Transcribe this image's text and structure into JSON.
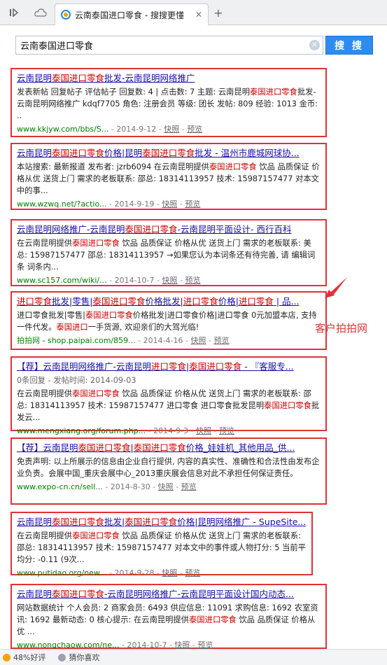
{
  "browser": {
    "tab_title": "云南泰国进口零食 - 搜搜更懂",
    "tab_close": "✕",
    "new_tab": "+"
  },
  "search": {
    "query": "云南泰国进口零食",
    "button_label": "搜 搜"
  },
  "results": [
    {
      "title": "云南昆明泰国进口零食批发-云南昆明网络推广",
      "snippet": "发表新帖 回复帖子 评估帖子 回复数: 4 | 点击数: 7 主题: 云南昆明泰国进口零食批发-云南昆明网络推广 kdqf7705 角色: 注册会员 等级: 团长 发帖: 809 经验: 1013 金币: ..",
      "url": "www.kkjyw.com/bbs/S...",
      "date": "2014-9-12",
      "snapshot": "快照",
      "preview": "预览"
    },
    {
      "title": "云南昆明泰国进口零食价格|昆明泰国进口零食批发 - 温州市鹿城网球协...",
      "snippet": "本站搜索: 最新报道 发布者: jzrb6094 在云南昆明提供泰国进口零食 饮品 品质保证 价格从优 送货上门 需求的老板联系: 邵总: 18314113957 技术: 15987157477 对本文中的事...",
      "url": "www.wzwq.net/?actio...",
      "date": "2014-9-19",
      "snapshot": "快照",
      "preview": "预览"
    },
    {
      "title": "云南昆明网络推广-云南昆明泰国进口零食-云南昆明平面设计- 西行百科",
      "snippet": "在云南昆明提供泰国进口零食 饮品 品质保证 价格从优 送货上门 需求的老板联系: 美总: 15987157477 邵总: 18314113957 →如果您认为本词条还有待完善, 请 编辑词条 词条内...",
      "url": "www.sc157.com/wiki/...",
      "date": "2014-10-7",
      "snapshot": "快照",
      "preview": "预览"
    },
    {
      "title": "进口零食批发|零售|泰国进口零食价格批发|进口零食价格|进口零食 | 品...",
      "snippet": "进口零食批发|零售|泰国进口零食价格批发|进口零食价格|进口零食 0元加盟本店, 支持一件代发。泰国进口一手货源, 欢迎亲们的大驾光临!",
      "url_prefix": "拍拍网",
      "url": "shop.paipai.com/859...",
      "date": "2014-4-16",
      "snapshot": "快照",
      "preview": "预览"
    },
    {
      "title": "【荐】云南昆明网络推广-云南昆明进口零食|泰国进口零食 - 『客服专...",
      "sub": "0条回复 - 发帖时间: 2014-09-03",
      "snippet": "在云南昆明提供泰国进口零食 饮品 品质保证 价格从优 送货上门 需求的老板联系: 邵总: 18314113957 技术: 15987157477 进口零食 进口零食批发昆明泰国进口零食批发云...",
      "url": "www.mengxiang.org/forum.php...",
      "date": "2014-9-3",
      "snapshot": "快照",
      "preview": "预览"
    },
    {
      "title": "【荐】云南昆明泰国进口零食|泰国进口零食价格_娃娃机_其他用品_供...",
      "snippet": "免责声明: 以上所展示的信息由企业自行提供, 内容的真实性、准确性和合法性由发布企业负责。会展中国_重庆会展中心_2013重庆展会信息对此不承担任何保证责任。",
      "url": "www.expo-cn.cn/sell...",
      "date": "2014-8-30",
      "snapshot": "快照",
      "preview": "预览"
    },
    {
      "title": "云南昆明泰国进口零食批发|泰国进口零食价格|昆明网络推广 - SupeSite...",
      "snippet": "在云南昆明提供泰国进口零食 饮品 品质保证 价格从优 送货上门 需求的老板联系: 邵总: 18314113957 技术: 15987157477 对本文中的事件或人物打分: 5 当前平均分: -0.11 (9次...",
      "url": "www.putidao.org/new...",
      "date": "2014-9-28",
      "snapshot": "快照",
      "preview": "预览"
    },
    {
      "title": "云南昆明泰国进口零食-云南昆明网络推广-云南昆明平面设计国内动态...",
      "snippet": "网站数据统计 个人会员: 2 商家会员: 6493 供应信息: 11091 求购信息: 1692 农室资讯: 1692 最新动态: 0 核心提示: 在云南昆明提供泰国进口零食 饮品 品质保证 价格从优 ...",
      "url": "www.nongchaow.com/ne...",
      "date": "2014-10-7",
      "snapshot": "快照",
      "preview": "预览"
    }
  ],
  "annotation": {
    "label": "客户拍拍网",
    "color": "#e03236"
  },
  "statusbar": {
    "rating": "48%好评",
    "guess": "猜你喜欢"
  },
  "colors": {
    "title_link": "#1a0dab",
    "highlight": "#cc0000",
    "url_green": "#008000",
    "box_red": "#e03236",
    "search_button": "#2d8cf0"
  }
}
